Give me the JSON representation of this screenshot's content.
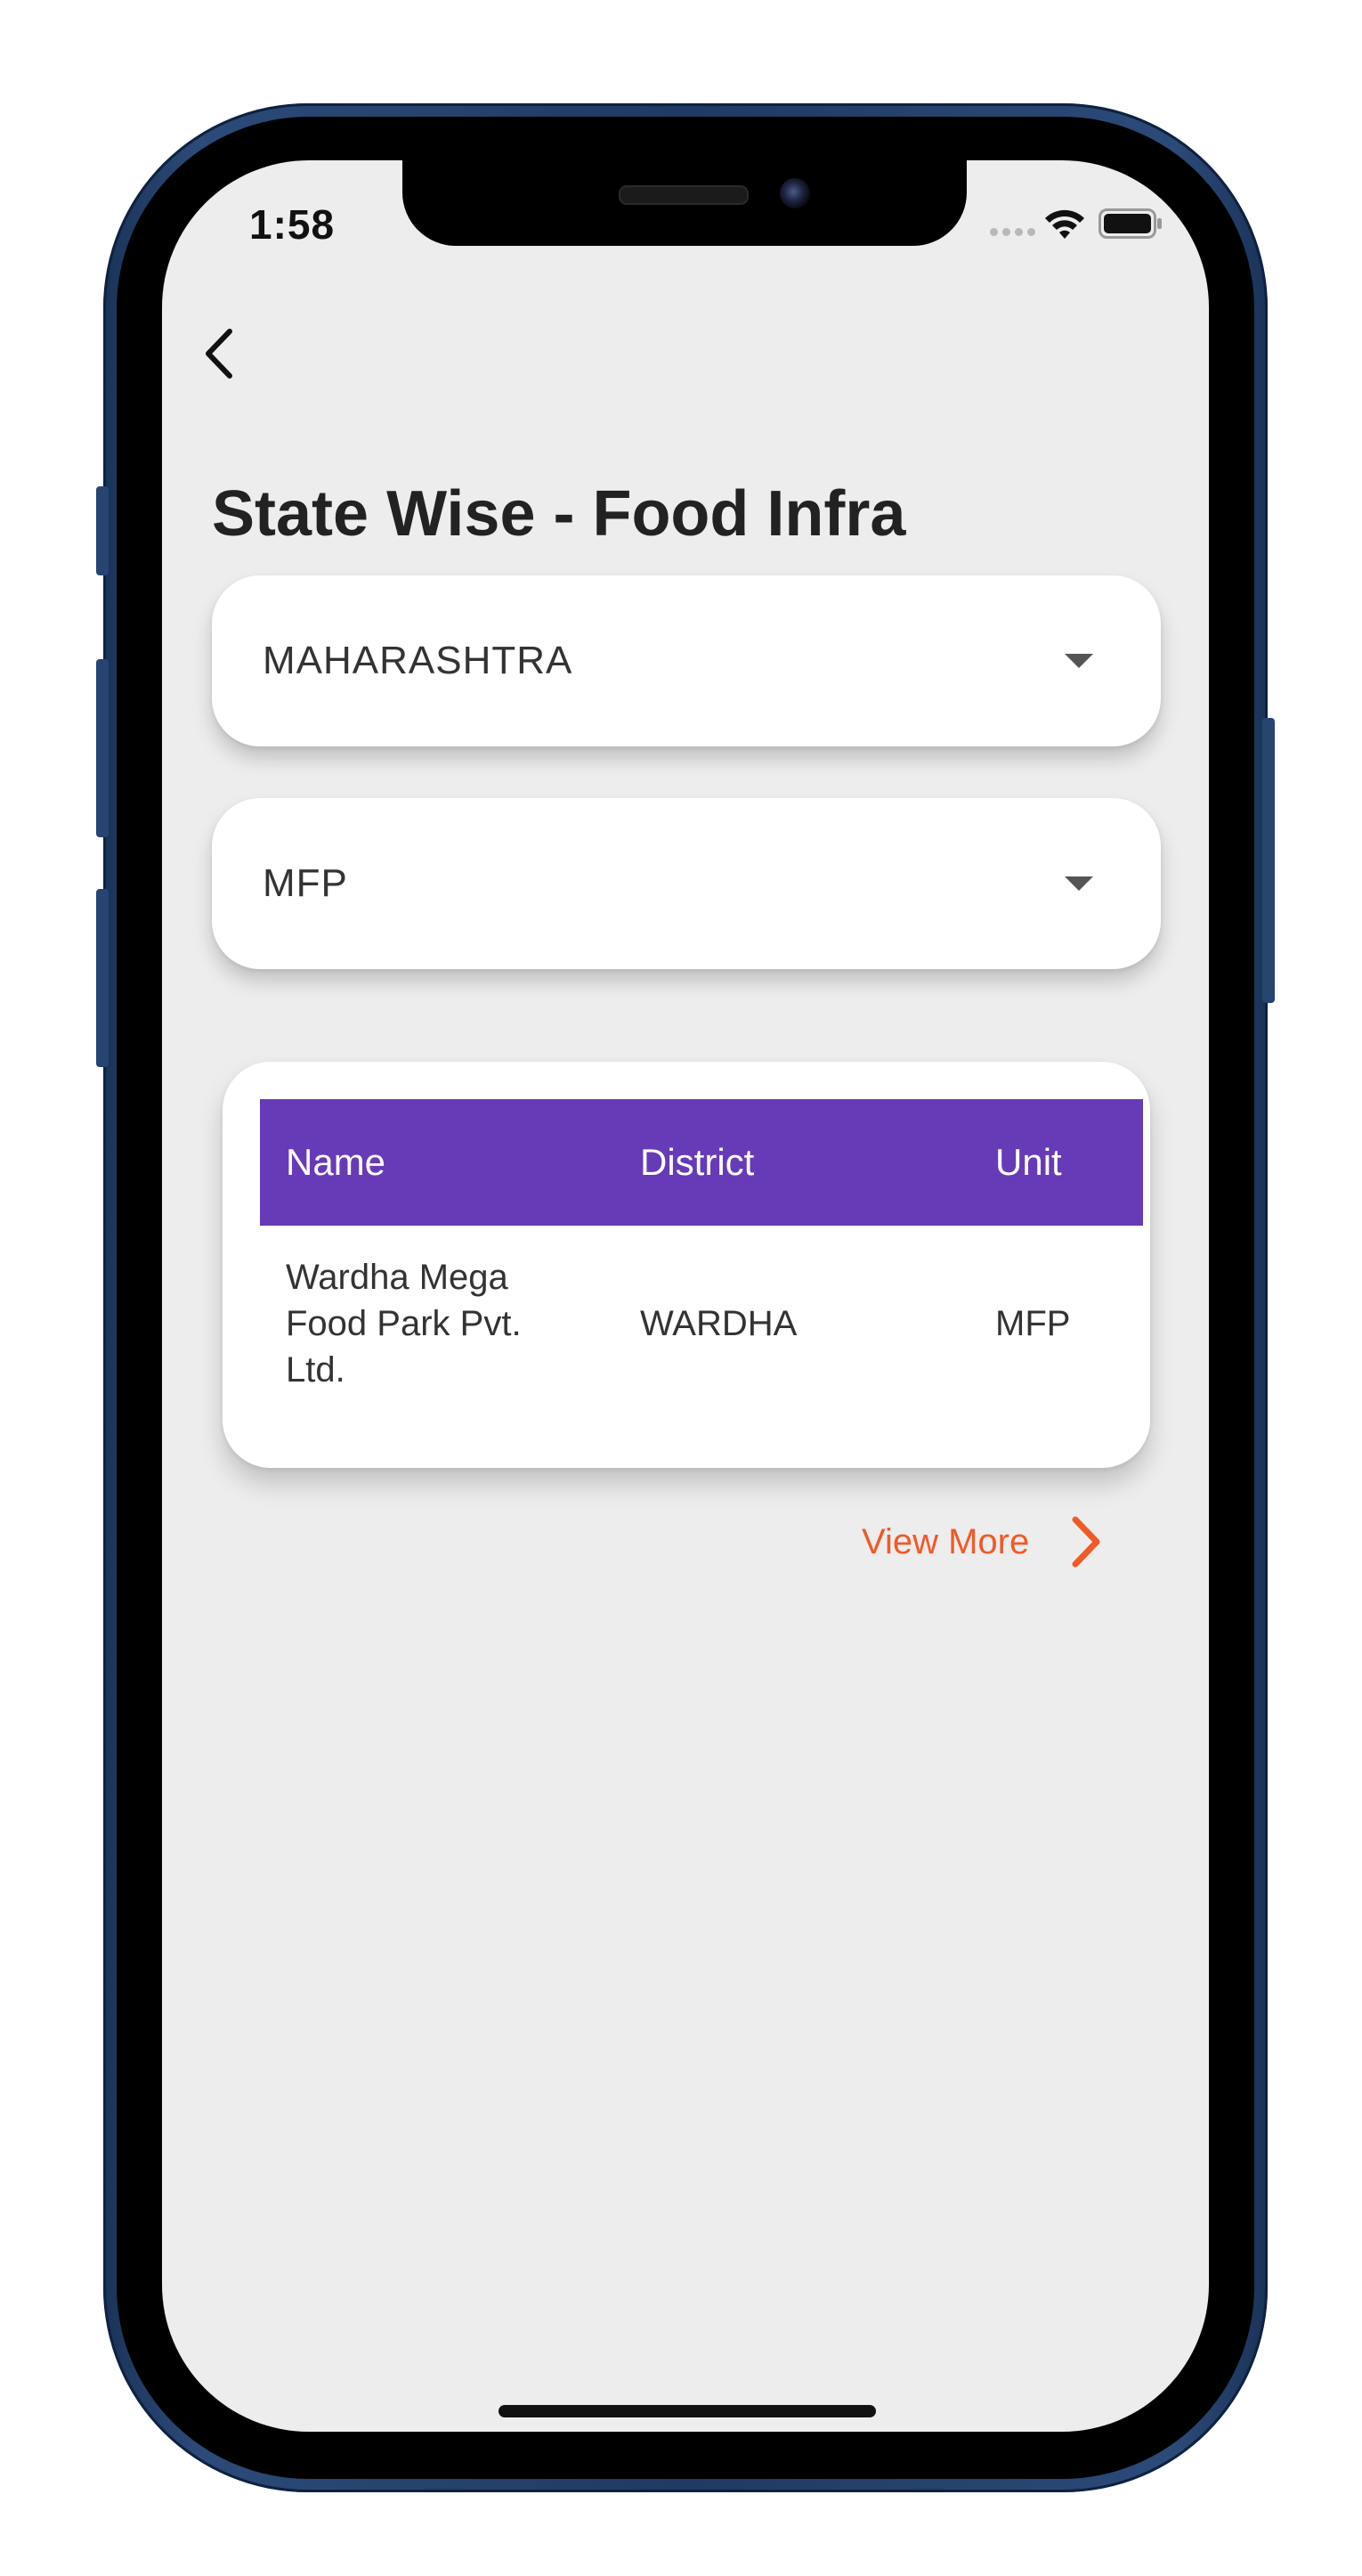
{
  "status_bar": {
    "time": "1:58"
  },
  "page": {
    "title": "State Wise - Food Infra"
  },
  "filters": {
    "state": {
      "selected": "MAHARASHTRA"
    },
    "type": {
      "selected": "MFP"
    }
  },
  "table": {
    "columns": [
      "Name",
      "District",
      "Unit"
    ],
    "rows": [
      {
        "name": "Wardha Mega Food Park Pvt. Ltd.",
        "district": "WARDHA",
        "unit": "MFP"
      }
    ]
  },
  "view_more": {
    "label": "View More"
  },
  "colors": {
    "table_header": "#673ab7",
    "accent": "#f05a28",
    "screen_background": "#ededed"
  },
  "icons": [
    "back-icon",
    "caret-down-icon",
    "chevron-right-icon",
    "wifi-icon",
    "battery-icon"
  ]
}
